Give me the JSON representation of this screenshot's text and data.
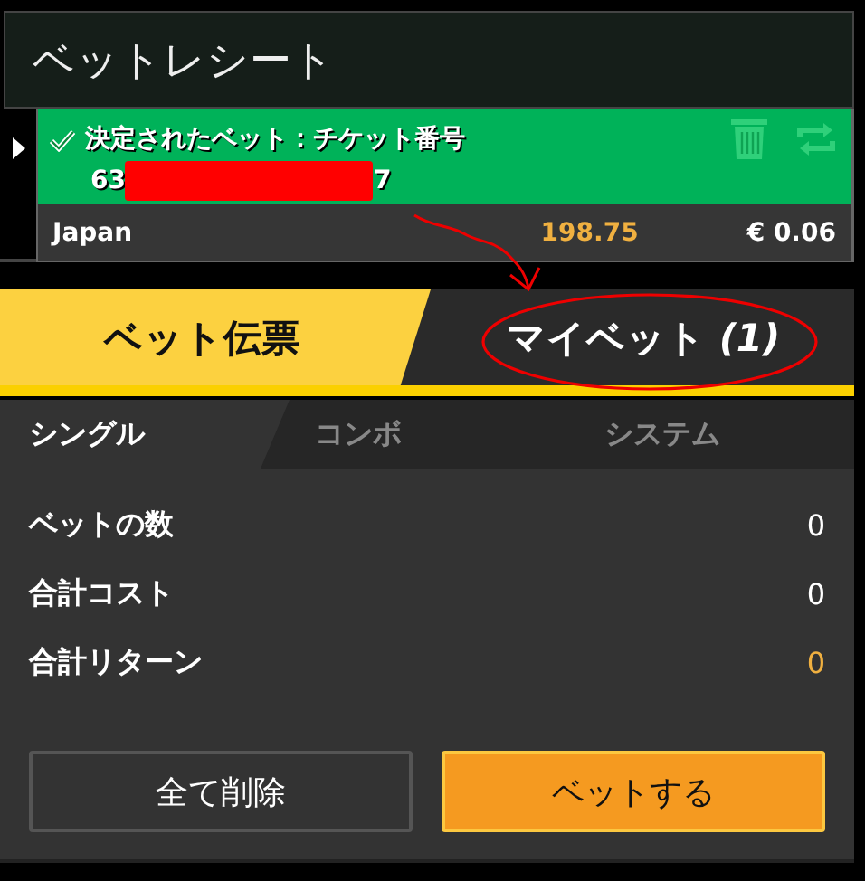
{
  "title": "ベットレシート",
  "receipt": {
    "confirmed": true,
    "heading": "決定されたベット：チケット番号",
    "ticket_prefix": "63",
    "redacted": true,
    "ticket_suffix": "7",
    "selection": "Japan",
    "odds": "198.75",
    "stake": "€ 0.06"
  },
  "tabs": [
    {
      "label": "ベット伝票",
      "selected": true
    },
    {
      "label": "マイベット *(1)*",
      "selected": false
    }
  ],
  "sub_tabs": [
    {
      "label": "シングル",
      "selected": true
    },
    {
      "label": "コンボ",
      "selected": false
    },
    {
      "label": "システム",
      "selected": false
    }
  ],
  "summary": [
    {
      "label": "ベットの数",
      "value": "0",
      "highlight": false
    },
    {
      "label": "合計コスト",
      "value": "0",
      "highlight": false
    },
    {
      "label": "合計リターン",
      "value": "0",
      "highlight": true
    }
  ],
  "buttons": [
    {
      "label": "全て削除",
      "kind": "secondary"
    },
    {
      "label": "ベットする",
      "kind": "primary"
    }
  ],
  "annotations": {
    "arrow": true,
    "circle": true
  }
}
